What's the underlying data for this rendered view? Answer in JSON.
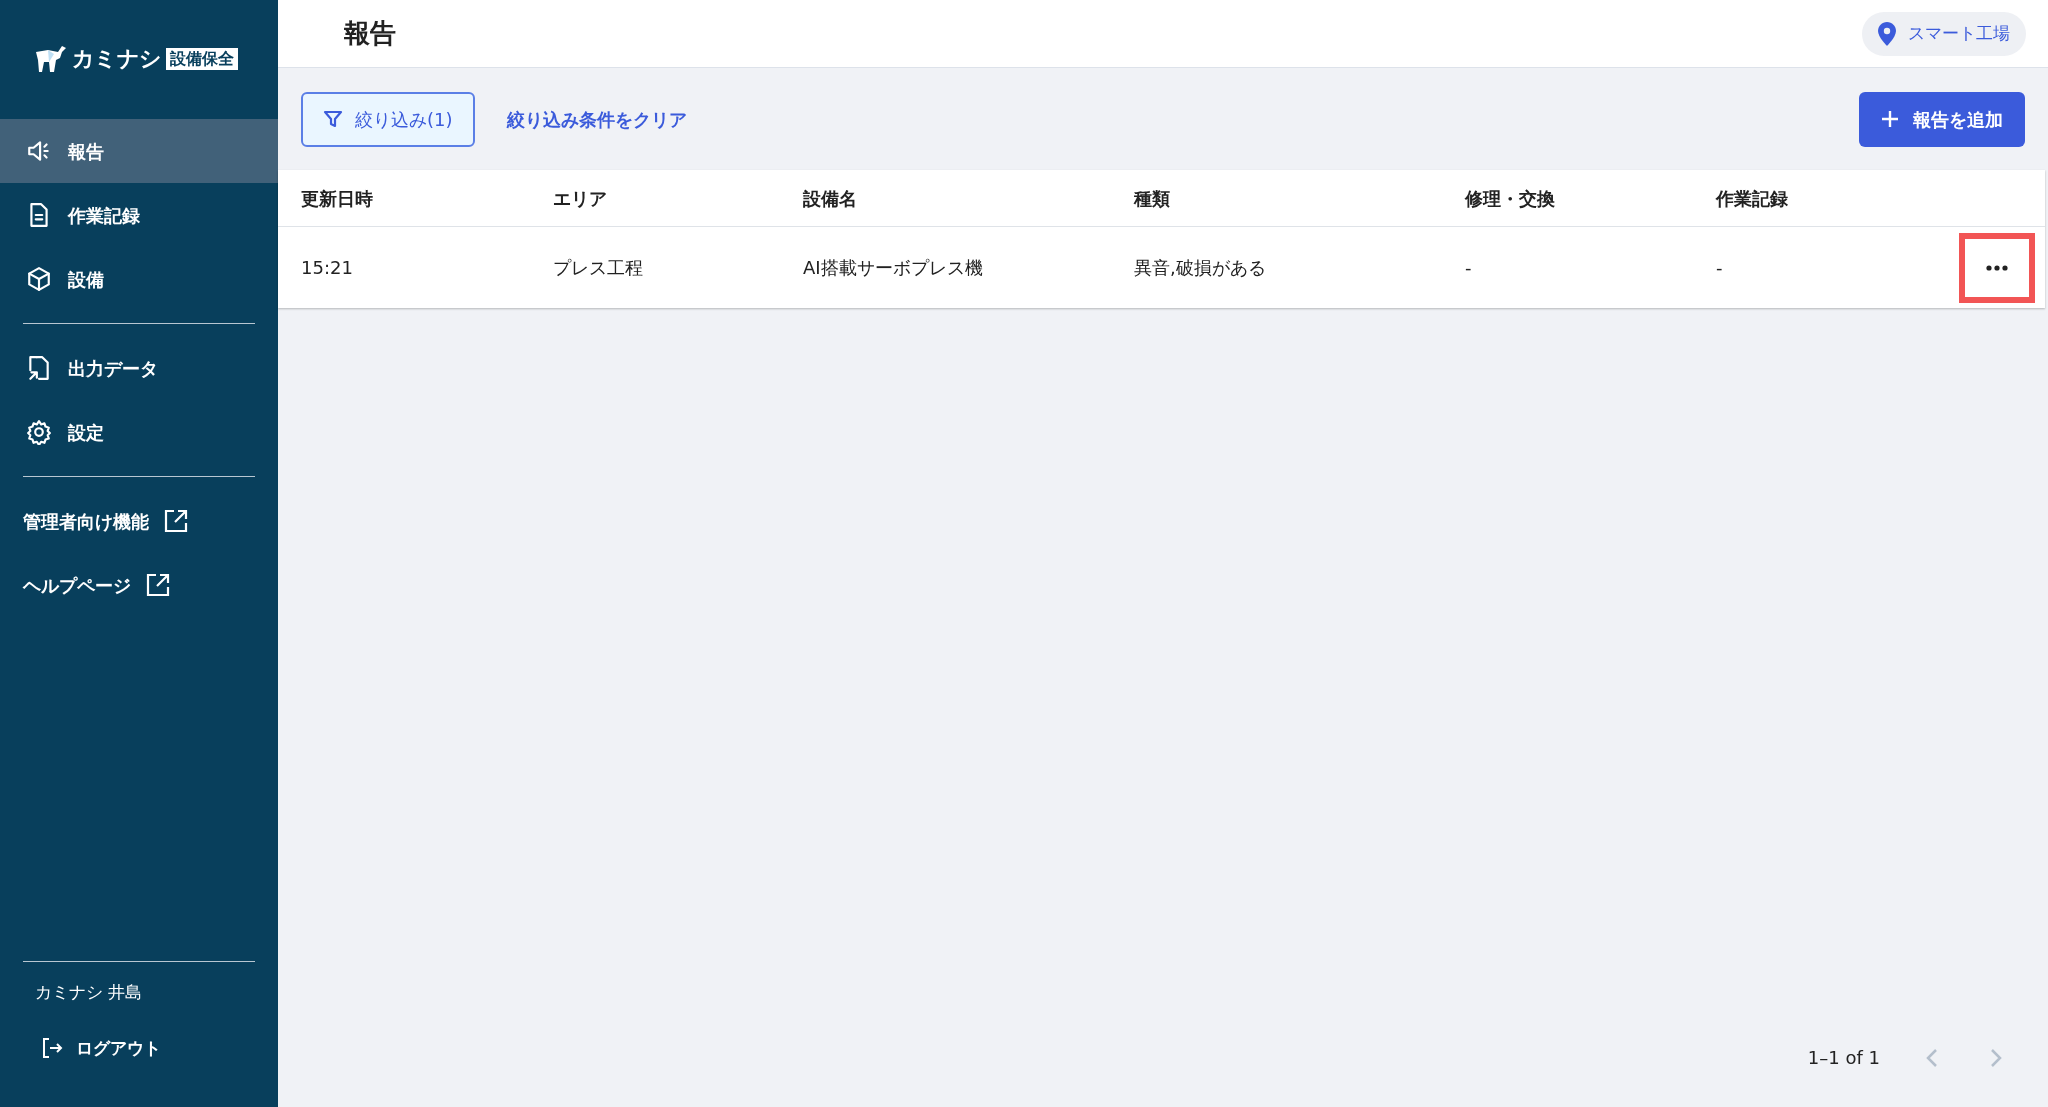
{
  "sidebar": {
    "logo": {
      "name": "カミナシ",
      "badge": "設備保全"
    },
    "nav": [
      {
        "kind": "report",
        "label": "報告",
        "selected": true
      },
      {
        "kind": "document",
        "label": "作業記録",
        "selected": false
      },
      {
        "kind": "box",
        "label": "設備",
        "selected": false
      },
      {
        "kind": "divider"
      },
      {
        "kind": "export",
        "label": "出力データ",
        "selected": false
      },
      {
        "kind": "gear",
        "label": "設定",
        "selected": false
      },
      {
        "kind": "divider"
      },
      {
        "kind": "external",
        "label": "管理者向け機能"
      },
      {
        "kind": "external",
        "label": "ヘルプページ"
      }
    ],
    "user": "カミナシ 井島",
    "logout": "ログアウト"
  },
  "header": {
    "title": "報告",
    "location": "スマート工場"
  },
  "toolbar": {
    "filter": "絞り込み(1)",
    "clear": "絞り込み条件をクリア",
    "add": "報告を追加"
  },
  "table": {
    "columns": [
      "更新日時",
      "エリア",
      "設備名",
      "種類",
      "修理・交換",
      "作業記録"
    ],
    "rows": [
      {
        "cells": [
          "15:21",
          "プレス工程",
          "AI搭載サーボプレス機",
          "異音,破損がある",
          "-",
          "-"
        ],
        "menu_highlighted": true
      }
    ]
  },
  "pagination": {
    "range": "1–1 of 1",
    "prev_disabled": true,
    "next_disabled": true
  }
}
